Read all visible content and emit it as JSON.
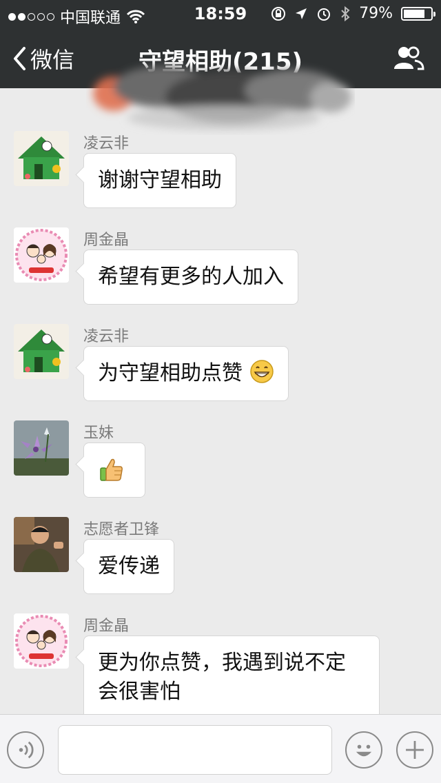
{
  "status_bar": {
    "carrier": "中国联通",
    "time": "18:59",
    "battery": "79%",
    "battery_level": 0.79,
    "signal_bars_filled": 2,
    "signal_bars_total": 5
  },
  "nav": {
    "back_label": "微信",
    "title": "守望相助(215)"
  },
  "messages": [
    {
      "sender": "凌云非",
      "text": "谢谢守望相助",
      "avatar": "house-avatar"
    },
    {
      "sender": "周金晶",
      "text": "希望有更多的人加入",
      "avatar": "family-avatar"
    },
    {
      "sender": "凌云非",
      "text": "为守望相助点赞",
      "avatar": "house-avatar",
      "emoji": "grin-emoji"
    },
    {
      "sender": "玉妹",
      "text": "",
      "avatar": "flower-avatar",
      "emoji": "thumbs-up-emoji"
    },
    {
      "sender": "志愿者卫锋",
      "text": "爱传递",
      "avatar": "man-avatar"
    },
    {
      "sender": "周金晶",
      "text_line1": "更为你点赞，我遇到说不定",
      "text_line2": "会很害怕",
      "avatar": "family-avatar"
    }
  ],
  "input_bar": {
    "placeholder": ""
  },
  "colors": {
    "header_bg": "#2e3132",
    "chat_bg": "#ebebeb",
    "bubble_bg": "#ffffff",
    "sender_text": "#7a7a7a"
  }
}
